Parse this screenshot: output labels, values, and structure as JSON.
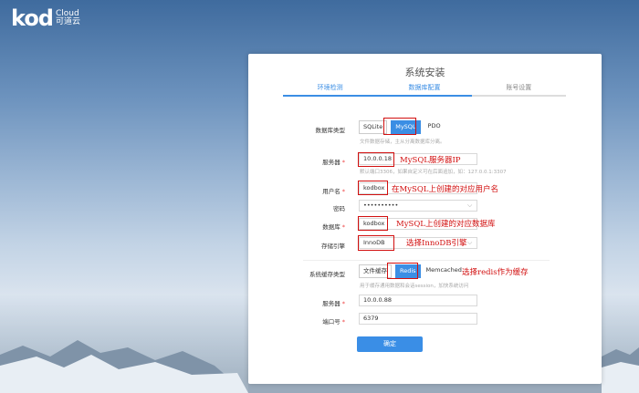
{
  "logo": {
    "main": "kod",
    "sub1": "Cloud",
    "sub2": "可道云"
  },
  "title": "系统安装",
  "steps": [
    {
      "label": "环境检测",
      "active": true
    },
    {
      "label": "数据库配置",
      "active": true
    },
    {
      "label": "账号设置",
      "active": false
    }
  ],
  "db": {
    "type_label": "数据库类型",
    "types": [
      "SQLite",
      "MySQL",
      "PDO"
    ],
    "selected": "MySQL",
    "type_hint": "文件数据存储，主从分离数据库分离。",
    "server_label": "服务器",
    "server_value": "10.0.0.18",
    "server_hint": "默认端口3306，如果自定义可在后面追加，如：127.0.0.1:3307",
    "user_label": "用户名",
    "user_value": "kodbox",
    "password_label": "密码",
    "password_value": "••••••••••",
    "name_label": "数据库",
    "name_value": "kodbox",
    "engine_label": "存储引擎",
    "engine_value": "InnoDB"
  },
  "cache": {
    "type_label": "系统缓存类型",
    "types": [
      "文件缓存",
      "Redis",
      "Memcached"
    ],
    "selected": "Redis",
    "hint": "用于缓存通用数据和会话session，加快系统访问",
    "server_label": "服务器",
    "server_value": "10.0.0.88",
    "port_label": "端口号",
    "port_value": "6379"
  },
  "confirm_label": "确定",
  "annotations": {
    "server": "MySQL服务器IP",
    "user": "在MySQL上创建的对应用户名",
    "dbname": "MySQL上创建的对应数据库",
    "engine": "选择InnoDB引擎",
    "cache": "选择redis作为缓存"
  },
  "colors": {
    "accent": "#3b8ee4",
    "annotation": "#d20f0f"
  }
}
